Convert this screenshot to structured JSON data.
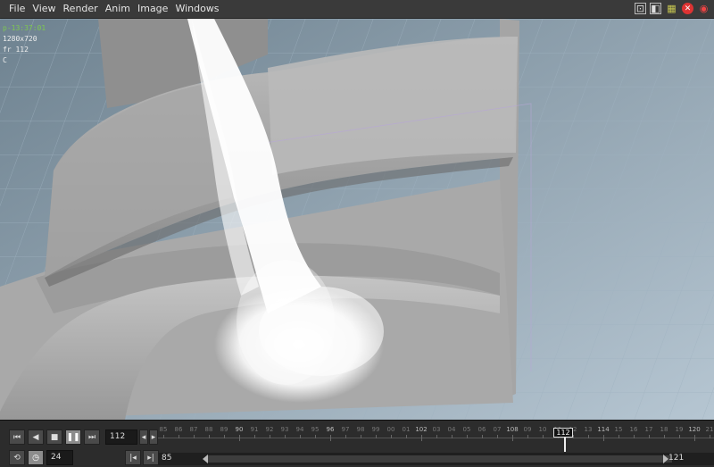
{
  "menu": [
    "File",
    "View",
    "Render",
    "Anim",
    "Image",
    "Windows"
  ],
  "menu_icons": [
    "viewport-layout-icon",
    "split-view-icon",
    "flipbook-icon",
    "close-icon",
    "record-icon"
  ],
  "viewport_info": {
    "time": "p-13:37:01",
    "resolution": "1280x720",
    "frame": "fr 112",
    "channel": "C"
  },
  "playback": {
    "current_frame": "112",
    "fps": "24",
    "range_start": "85",
    "range_end": "121",
    "marker": "112",
    "ticks": [
      "85",
      "86",
      "87",
      "88",
      "89",
      "90",
      "91",
      "92",
      "93",
      "94",
      "95",
      "96",
      "97",
      "98",
      "99",
      "00",
      "01",
      "102",
      "03",
      "04",
      "05",
      "06",
      "07",
      "108",
      "09",
      "10",
      "11",
      "12",
      "13",
      "114",
      "15",
      "16",
      "17",
      "18",
      "19",
      "120",
      "21"
    ]
  },
  "colors": {
    "accent": "#7ec850",
    "grid": "#8ea3b3",
    "mesh": "#b4b4b4"
  }
}
